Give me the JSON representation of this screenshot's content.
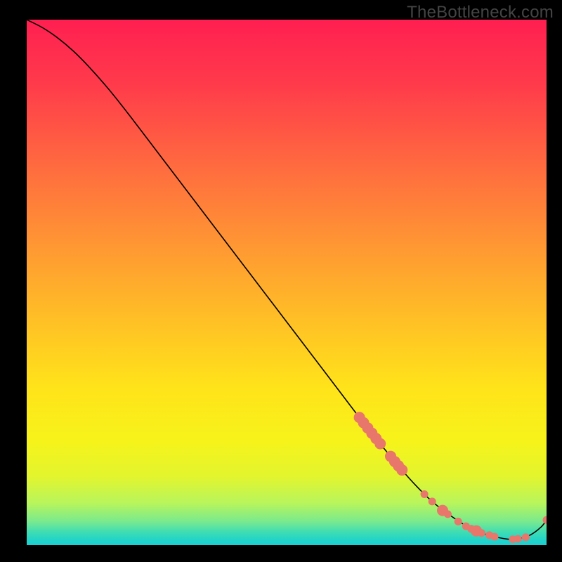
{
  "watermark": "TheBottleneck.com",
  "chart_data": {
    "type": "line",
    "title": "",
    "xlabel": "",
    "ylabel": "",
    "xlim": [
      0,
      100
    ],
    "ylim": [
      0,
      100
    ],
    "gradient_stops": [
      {
        "offset": 0.0,
        "color": "#ff1f51"
      },
      {
        "offset": 0.12,
        "color": "#ff3a4b"
      },
      {
        "offset": 0.28,
        "color": "#ff6b3f"
      },
      {
        "offset": 0.44,
        "color": "#ff9a32"
      },
      {
        "offset": 0.58,
        "color": "#ffc225"
      },
      {
        "offset": 0.7,
        "color": "#ffe31a"
      },
      {
        "offset": 0.8,
        "color": "#f7f31a"
      },
      {
        "offset": 0.87,
        "color": "#e2f52e"
      },
      {
        "offset": 0.92,
        "color": "#b8f55c"
      },
      {
        "offset": 0.955,
        "color": "#7ae98e"
      },
      {
        "offset": 0.975,
        "color": "#3fddb3"
      },
      {
        "offset": 0.99,
        "color": "#22d4c8"
      },
      {
        "offset": 1.0,
        "color": "#1bd0d4"
      }
    ],
    "series": [
      {
        "name": "bottleneck-curve",
        "x": [
          0,
          3,
          6,
          9,
          12,
          16,
          20,
          25,
          30,
          35,
          40,
          45,
          50,
          55,
          60,
          64,
          68,
          72,
          75,
          78,
          81,
          84,
          87,
          90,
          93,
          95,
          97,
          99,
          100
        ],
        "y": [
          100,
          98.5,
          96.5,
          94,
          91,
          86.5,
          81.5,
          75,
          68.5,
          62,
          55.5,
          49,
          42.5,
          36,
          29.5,
          24.3,
          19.3,
          14.5,
          11.2,
          8.3,
          6,
          4,
          2.5,
          1.6,
          1.1,
          1.3,
          2,
          3.5,
          4.8
        ]
      }
    ],
    "markers": {
      "name": "highlight-points",
      "color": "#e8766b",
      "radius_small": 5.5,
      "radius_large": 8,
      "points": [
        {
          "x": 64.0,
          "y": 24.3,
          "r": "l"
        },
        {
          "x": 64.8,
          "y": 23.3,
          "r": "l"
        },
        {
          "x": 65.6,
          "y": 22.3,
          "r": "l"
        },
        {
          "x": 66.4,
          "y": 21.3,
          "r": "l"
        },
        {
          "x": 67.2,
          "y": 20.3,
          "r": "l"
        },
        {
          "x": 68.0,
          "y": 19.3,
          "r": "l"
        },
        {
          "x": 70.0,
          "y": 16.9,
          "r": "l"
        },
        {
          "x": 70.8,
          "y": 15.9,
          "r": "l"
        },
        {
          "x": 71.5,
          "y": 15.1,
          "r": "l"
        },
        {
          "x": 72.2,
          "y": 14.3,
          "r": "l"
        },
        {
          "x": 76.5,
          "y": 9.7,
          "r": "s"
        },
        {
          "x": 78.0,
          "y": 8.3,
          "r": "s"
        },
        {
          "x": 80.0,
          "y": 6.6,
          "r": "l"
        },
        {
          "x": 81.0,
          "y": 5.9,
          "r": "s"
        },
        {
          "x": 83.0,
          "y": 4.5,
          "r": "s"
        },
        {
          "x": 84.5,
          "y": 3.6,
          "r": "s"
        },
        {
          "x": 85.5,
          "y": 3.1,
          "r": "s"
        },
        {
          "x": 86.5,
          "y": 2.7,
          "r": "l"
        },
        {
          "x": 87.5,
          "y": 2.3,
          "r": "s"
        },
        {
          "x": 89.0,
          "y": 1.9,
          "r": "s"
        },
        {
          "x": 90.0,
          "y": 1.6,
          "r": "s"
        },
        {
          "x": 93.5,
          "y": 1.1,
          "r": "s"
        },
        {
          "x": 94.5,
          "y": 1.2,
          "r": "s"
        },
        {
          "x": 96.0,
          "y": 1.5,
          "r": "s"
        },
        {
          "x": 100.0,
          "y": 4.8,
          "r": "s"
        }
      ]
    }
  }
}
